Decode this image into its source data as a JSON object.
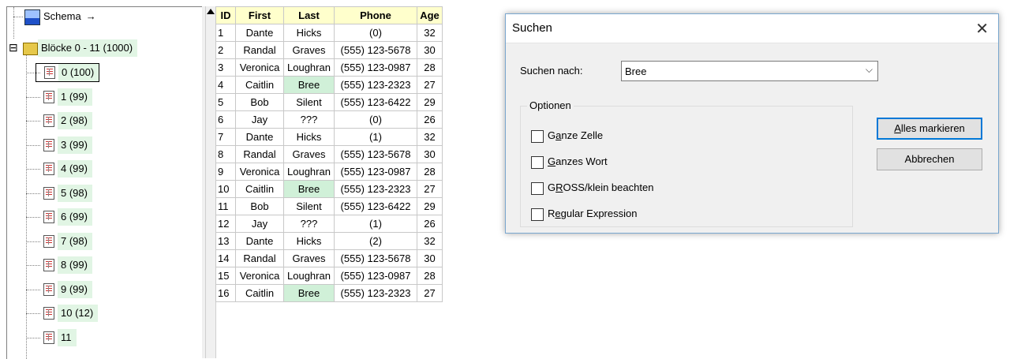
{
  "tree": {
    "schema_label": "Schema",
    "schema_arrow": "→",
    "expander": "⊟",
    "root_label": "Blöcke 0 - 11 (1000)",
    "items": [
      {
        "label": "0 (100)"
      },
      {
        "label": "1 (99)"
      },
      {
        "label": "2 (98)"
      },
      {
        "label": "3 (99)"
      },
      {
        "label": "4 (99)"
      },
      {
        "label": "5 (98)"
      },
      {
        "label": "6 (99)"
      },
      {
        "label": "7 (98)"
      },
      {
        "label": "8 (99)"
      },
      {
        "label": "9 (99)"
      },
      {
        "label": "10 (12)"
      },
      {
        "label": "11"
      }
    ]
  },
  "grid": {
    "headers": [
      "ID",
      "First",
      "Last",
      "Phone",
      "Age"
    ],
    "rows": [
      [
        "1",
        "Dante",
        "Hicks",
        "(0)",
        "32"
      ],
      [
        "2",
        "Randal",
        "Graves",
        "(555) 123-5678",
        "30"
      ],
      [
        "3",
        "Veronica",
        "Loughran",
        "(555) 123-0987",
        "28"
      ],
      [
        "4",
        "Caitlin",
        "Bree",
        "(555) 123-2323",
        "27"
      ],
      [
        "5",
        "Bob",
        "Silent",
        "(555) 123-6422",
        "29"
      ],
      [
        "6",
        "Jay",
        "???",
        "(0)",
        "26"
      ],
      [
        "7",
        "Dante",
        "Hicks",
        "(1)",
        "32"
      ],
      [
        "8",
        "Randal",
        "Graves",
        "(555) 123-5678",
        "30"
      ],
      [
        "9",
        "Veronica",
        "Loughran",
        "(555) 123-0987",
        "28"
      ],
      [
        "10",
        "Caitlin",
        "Bree",
        "(555) 123-2323",
        "27"
      ],
      [
        "11",
        "Bob",
        "Silent",
        "(555) 123-6422",
        "29"
      ],
      [
        "12",
        "Jay",
        "???",
        "(1)",
        "26"
      ],
      [
        "13",
        "Dante",
        "Hicks",
        "(2)",
        "32"
      ],
      [
        "14",
        "Randal",
        "Graves",
        "(555) 123-5678",
        "30"
      ],
      [
        "15",
        "Veronica",
        "Loughran",
        "(555) 123-0987",
        "28"
      ],
      [
        "16",
        "Caitlin",
        "Bree",
        "(555) 123-2323",
        "27"
      ]
    ]
  },
  "dialog": {
    "title": "Suchen",
    "close_glyph": "✕",
    "search_label": "Suchen nach:",
    "search_value": "Bree",
    "dropdown_glyph": "⌵",
    "options_title": "Optionen",
    "options": [
      {
        "pre": "G",
        "ul": "a",
        "post": "nze Zelle"
      },
      {
        "pre": "",
        "ul": "G",
        "post": "anzes Wort"
      },
      {
        "pre": "G",
        "ul": "R",
        "post": "OSS/klein beachten"
      },
      {
        "pre": "R",
        "ul": "e",
        "post": "gular Expression"
      }
    ],
    "mark_all": {
      "ul": "A",
      "rest": "lles markieren"
    },
    "cancel": "Abbrechen"
  },
  "colors": {
    "header_bg": "#ffffcc",
    "match_bg": "#d0f0d8",
    "tree_highlight": "#e1f5e4",
    "default_button_border": "#0078d7"
  }
}
